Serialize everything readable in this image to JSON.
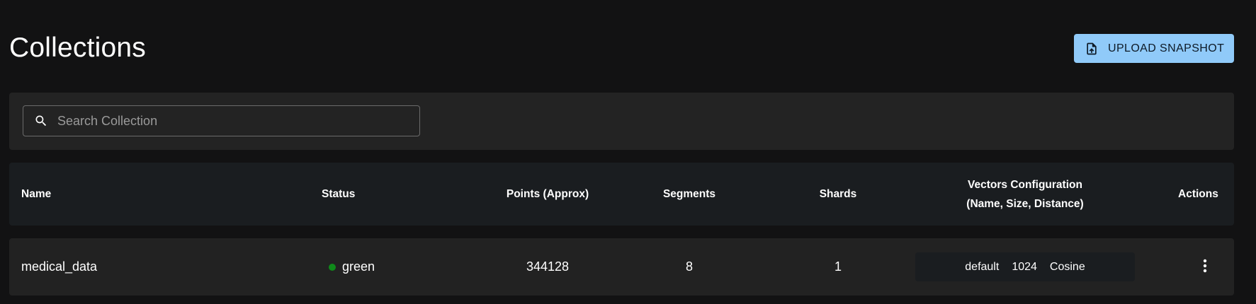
{
  "header": {
    "title": "Collections",
    "upload_button_label": "UPLOAD SNAPSHOT",
    "upload_icon": "file-upload-icon"
  },
  "search": {
    "placeholder": "Search Collection",
    "value": "",
    "icon": "search-icon"
  },
  "table": {
    "columns": {
      "name": "Name",
      "status": "Status",
      "points": "Points (Approx)",
      "segments": "Segments",
      "shards": "Shards",
      "vectors_line1": "Vectors Configuration",
      "vectors_line2": "(Name, Size, Distance)",
      "actions": "Actions"
    },
    "rows": [
      {
        "name": "medical_data",
        "status": "green",
        "status_color": "#0f8a1a",
        "points": "344128",
        "segments": "8",
        "shards": "1",
        "vector_name": "default",
        "vector_size": "1024",
        "vector_distance": "Cosine",
        "actions_icon": "more-vertical-icon"
      }
    ]
  },
  "colors": {
    "background": "#121213",
    "panel": "#232323",
    "header_bg": "#1a1d20",
    "accent": "#90caf9"
  }
}
